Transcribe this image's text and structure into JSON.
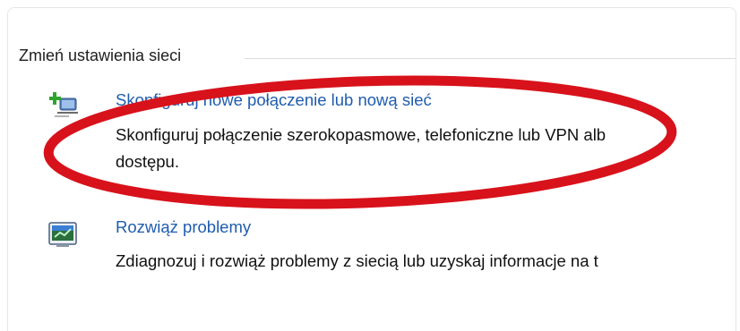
{
  "section": {
    "title": "Zmień ustawienia sieci"
  },
  "tasks": [
    {
      "icon": "new-connection-icon",
      "link": "Skonfiguruj nowe połączenie lub nową sieć",
      "description_line1": "Skonfiguruj połączenie szerokopasmowe, telefoniczne lub VPN alb",
      "description_line2": "dostępu."
    },
    {
      "icon": "troubleshoot-icon",
      "link": "Rozwiąż problemy",
      "description_line1": "Zdiagnozuj i rozwiąż problemy z siecią lub uzyskaj informacje na t"
    }
  ],
  "colors": {
    "link": "#1f5cae",
    "text": "#111111",
    "annotation": "#d8121b"
  }
}
